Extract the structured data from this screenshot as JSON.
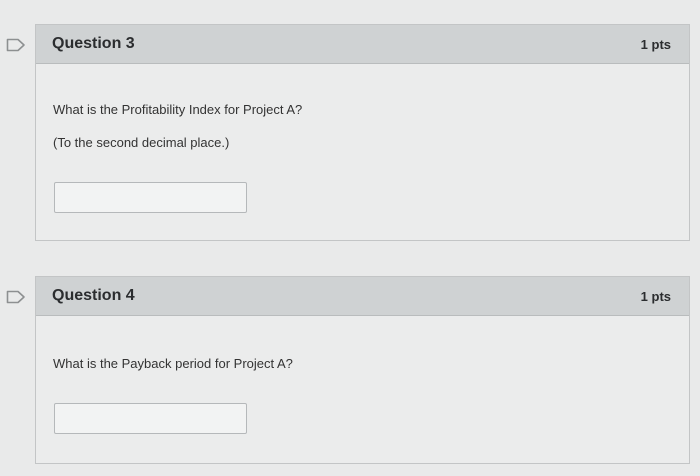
{
  "questions": [
    {
      "title": "Question 3",
      "points": "1 pts",
      "text": "What is the Profitability Index for Project A?",
      "note": "(To the second decimal place.)",
      "answer_value": ""
    },
    {
      "title": "Question 4",
      "points": "1 pts",
      "text": "What is the Payback period for Project A?",
      "answer_value": ""
    }
  ],
  "icons": {
    "flag": "flag-outline-icon"
  },
  "colors": {
    "header_bg": "#cfd2d3",
    "card_bg": "#ebecec",
    "flag_stroke": "#8d9091"
  }
}
